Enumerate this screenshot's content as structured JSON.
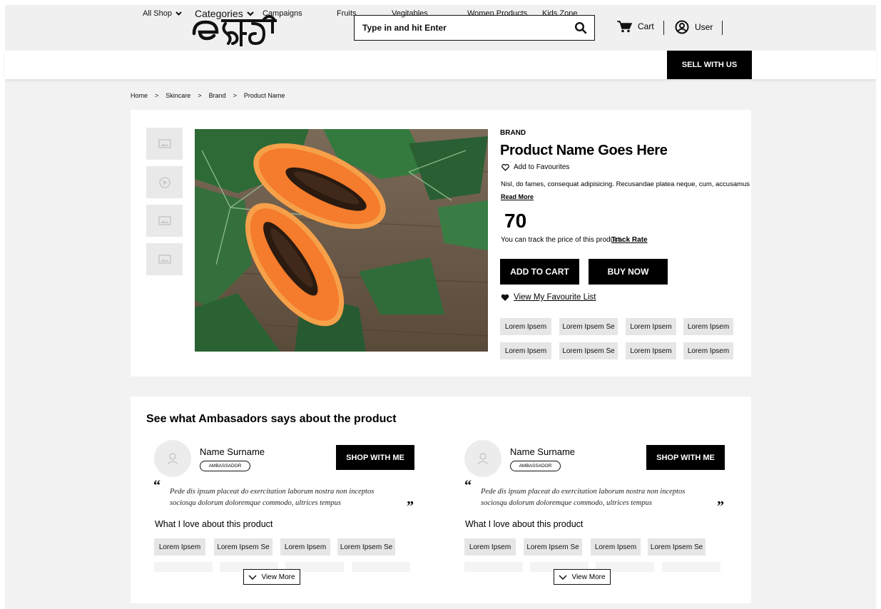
{
  "header": {
    "logo_text": "e হাট",
    "search": {
      "placeholder": "Type in and hit Enter"
    },
    "cart_label": "Cart",
    "user_label": "User"
  },
  "nav": {
    "items": [
      "All Shop",
      "Categories",
      "Campaigns",
      "Fruits",
      "Vegitables",
      "Women Products",
      "Kids Zone"
    ],
    "sell_label": "SELL WITH US"
  },
  "breadcrumb": [
    "Home",
    ">",
    "Skincare",
    ">",
    "Brand",
    ">",
    "Product Name"
  ],
  "product": {
    "brand": "BRAND",
    "name": "Product Name Goes Here",
    "add_fav": "Add to Favourites",
    "description": "Nisl, do fames, consequat adipisicing. Recusandae platea neque, cum, accusamus",
    "read_more": "Read More",
    "price": "70",
    "track_text": "You can track the price of this product",
    "track_link": "Track Rate",
    "add_to_cart": "ADD TO CART",
    "buy_now": "BUY NOW",
    "fav_list": "View My Favourite List",
    "tags": [
      "Lorem Ipsem",
      "Lorem Ipsem Se",
      "Lorem Ipsem",
      "Lorem Ipsem",
      "Lorem Ipsem",
      "Lorem Ipsem Se",
      "Lorem Ipsem",
      "Lorem Ipsem"
    ]
  },
  "ambassadors": {
    "title": "See what Ambasadors says about the product",
    "cards": [
      {
        "name": "Name Surname",
        "badge": "AMBASSADOR",
        "cta": "SHOP WITH ME",
        "quote": "Pede dis ipsum placeat do exercitation laborum nostra non inceptos sociosqu dolorum doloremque commodo, ultrices tempus",
        "love_title": "What I love about this product",
        "tags": [
          "Lorem Ipsem",
          "Lorem Ipsem Se",
          "Lorem Ipsem",
          "Lorem Ipsem Se"
        ],
        "view_more": "View More"
      },
      {
        "name": "Name Surname",
        "badge": "AMBASSADOR",
        "cta": "SHOP WITH ME",
        "quote": "Pede dis ipsum placeat do exercitation laborum nostra non inceptos sociosqu dolorum doloremque commodo, ultrices tempus",
        "love_title": "What I love about this product",
        "tags": [
          "Lorem Ipsem",
          "Lorem Ipsem Se",
          "Lorem Ipsem",
          "Lorem Ipsem Se"
        ],
        "view_more": "View More"
      }
    ]
  },
  "colors": {
    "primary": "#000000",
    "tag_bg": "#e6e6e6",
    "page_bg": "#f2f2f2",
    "papaya": "#f07a2e",
    "leaf": "#2e6b3a"
  }
}
